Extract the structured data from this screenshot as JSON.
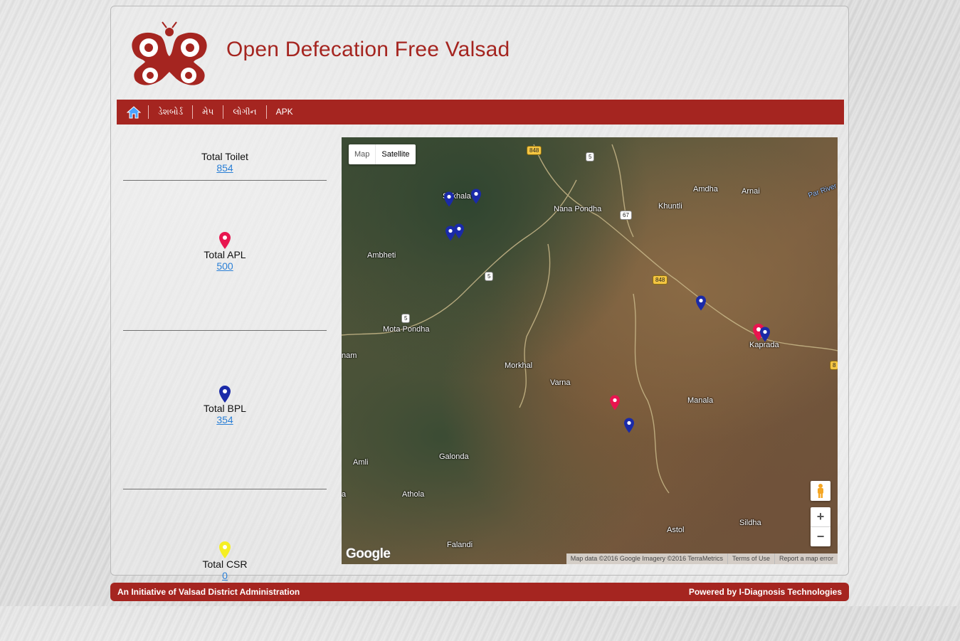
{
  "header": {
    "title": "Open Defecation Free Valsad"
  },
  "nav": {
    "items": [
      {
        "label": "ડેશબોર્ડ"
      },
      {
        "label": "મેપ"
      },
      {
        "label": "લોગીન"
      },
      {
        "label": "APK"
      }
    ]
  },
  "stats": [
    {
      "label": "Total Toilet",
      "value": "854",
      "pin_color": ""
    },
    {
      "label": "Total APL",
      "value": "500",
      "pin_color": "#e8154f"
    },
    {
      "label": "Total BPL",
      "value": "354",
      "pin_color": "#1a2aa8"
    },
    {
      "label": "Total CSR",
      "value": "0",
      "pin_color": "#f5ef23"
    }
  ],
  "map": {
    "type_buttons": {
      "map": "Map",
      "satellite": "Satellite"
    },
    "places": [
      "Sukhala",
      "Nana Pondha",
      "Khuntli",
      "Amdha",
      "Arnai",
      "Ambheti",
      "Mota Pondha",
      "Kaprada",
      "Morkhal",
      "Varna",
      "Manala",
      "Amli",
      "Galonda",
      "Athola",
      "Falandi",
      "Astol",
      "Sildha",
      "Par River",
      "nam",
      "a"
    ],
    "road_shields": [
      "848",
      "5",
      "67",
      "848",
      "5",
      "5",
      "8"
    ],
    "zoom_in": "+",
    "zoom_out": "−",
    "google_logo": "Google",
    "attribution": [
      "Map data ©2016 Google Imagery ©2016 TerraMetrics",
      "Terms of Use",
      "Report a map error"
    ],
    "apl_color": "#e8154f",
    "bpl_color": "#1a2aa8"
  },
  "footer": {
    "left": "An Initiative of Valsad District Administration",
    "right": "Powered by I-Diagnosis Technologies"
  },
  "colors": {
    "brand": "#a52520",
    "link": "#2a7fd6"
  }
}
